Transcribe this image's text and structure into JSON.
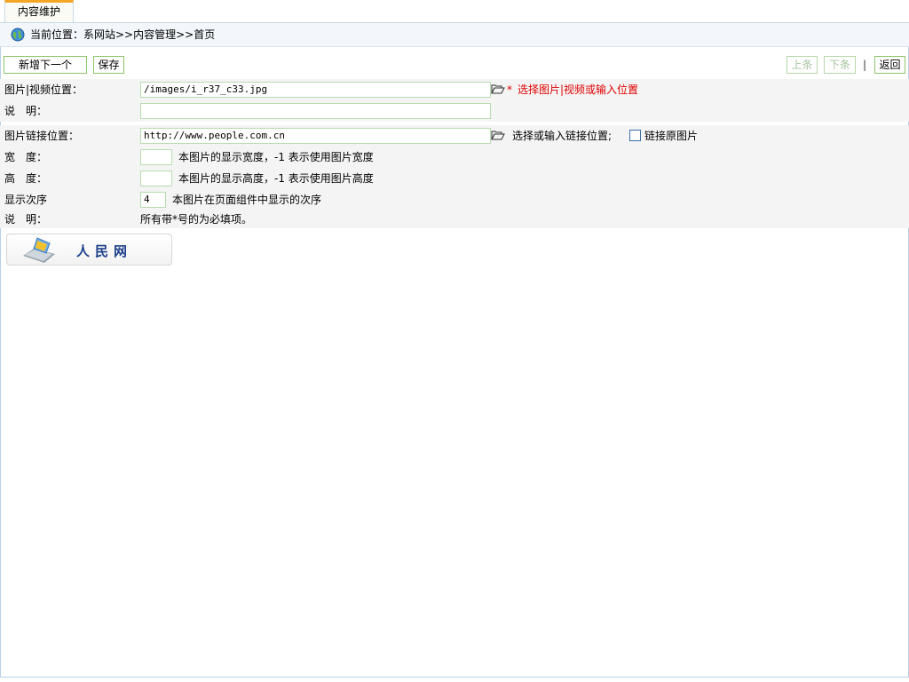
{
  "tab": {
    "label": "内容维护"
  },
  "location": {
    "text": "当前位置：系网站>>内容管理>>首页",
    "icon": "globe-icon"
  },
  "toolbar": {
    "add_next": "新增下一个",
    "save": "保存",
    "prev": "上条",
    "next": "下条",
    "separator": "|",
    "back": "返回"
  },
  "form": {
    "image": {
      "label": "图片|视频位置：",
      "value": "/images/i_r37_c33.jpg",
      "required_mark": "*",
      "hint": "选择图片|视频或输入位置"
    },
    "desc": {
      "label": "说　明：",
      "value": ""
    },
    "link": {
      "label": "图片链接位置：",
      "value": "http://www.people.com.cn",
      "hint": "选择或输入链接位置;",
      "checkbox_label": "链接原图片",
      "checked": false
    },
    "width": {
      "label": "宽　度：",
      "value": "",
      "hint": "本图片的显示宽度，-1 表示使用图片宽度"
    },
    "height": {
      "label": "高　度：",
      "value": "",
      "hint": "本图片的显示高度，-1 表示使用图片高度"
    },
    "order": {
      "label": "显示次序",
      "value": "4",
      "hint": "本图片在页面组件中显示的次序"
    },
    "note": {
      "label": "说　明：",
      "text": "所有带*号的为必填项。"
    }
  },
  "preview": {
    "logo_text": "人民网"
  },
  "colors": {
    "accent": "#f5a623",
    "button_border": "#8cc46c",
    "required": "#e00000",
    "row_bg": "#f4f4f4"
  }
}
